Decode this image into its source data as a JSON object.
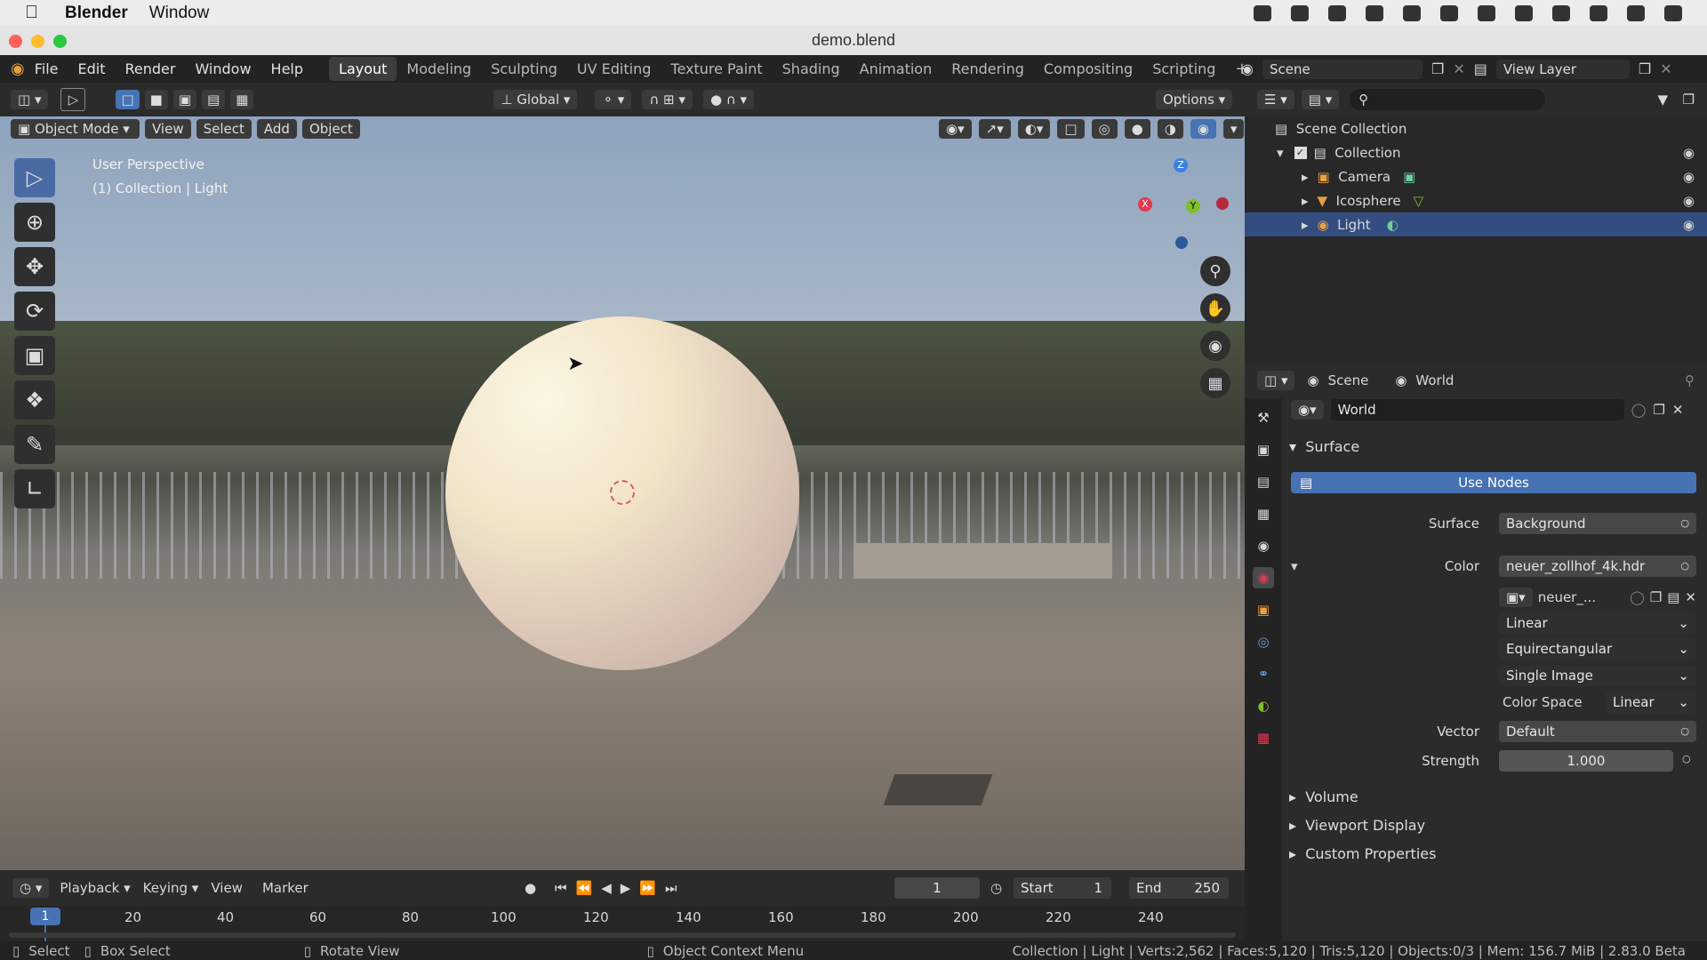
{
  "mac_menubar": {
    "app_name": "Blender",
    "menu_window": "Window"
  },
  "window": {
    "title": "demo.blend"
  },
  "topbar": {
    "menus": [
      "File",
      "Edit",
      "Render",
      "Window",
      "Help"
    ],
    "workspaces": [
      "Layout",
      "Modeling",
      "Sculpting",
      "UV Editing",
      "Texture Paint",
      "Shading",
      "Animation",
      "Rendering",
      "Compositing",
      "Scripting"
    ],
    "active_workspace": "Layout",
    "scene_name": "Scene",
    "view_layer": "View Layer"
  },
  "viewport": {
    "transform_orientation": "Global",
    "options_label": "Options",
    "mode": "Object Mode",
    "header_menus": [
      "View",
      "Select",
      "Add",
      "Object"
    ],
    "overlay_line1": "User Perspective",
    "overlay_line2": "(1) Collection | Light",
    "gizmo_axes": {
      "x": "X",
      "y": "Y",
      "z": "Z"
    }
  },
  "outliner": {
    "root": "Scene Collection",
    "collection": "Collection",
    "items": [
      {
        "label": "Camera",
        "icon": "camera-icon"
      },
      {
        "label": "Icosphere",
        "icon": "mesh-icon"
      },
      {
        "label": "Light",
        "icon": "light-icon",
        "selected": true
      }
    ]
  },
  "properties": {
    "breadcrumb_scene": "Scene",
    "breadcrumb_world": "World",
    "world_name": "World",
    "section_surface": "Surface",
    "use_nodes_label": "Use Nodes",
    "surface_label": "Surface",
    "surface_value": "Background",
    "color_label": "Color",
    "color_value": "neuer_zollhof_4k.hdr",
    "image_short": "neuer_...",
    "interpolation": "Linear",
    "projection": "Equirectangular",
    "source": "Single Image",
    "color_space_label": "Color Space",
    "color_space_value": "Linear",
    "vector_label": "Vector",
    "vector_value": "Default",
    "strength_label": "Strength",
    "strength_value": "1.000",
    "section_volume": "Volume",
    "section_viewport_display": "Viewport Display",
    "section_custom_properties": "Custom Properties"
  },
  "timeline": {
    "playback": "Playback",
    "keying": "Keying",
    "view": "View",
    "marker": "Marker",
    "current_frame": "1",
    "start_label": "Start",
    "start_value": "1",
    "end_label": "End",
    "end_value": "250",
    "ruler_ticks": [
      "1",
      "20",
      "40",
      "60",
      "80",
      "100",
      "120",
      "140",
      "160",
      "180",
      "200",
      "220",
      "240"
    ]
  },
  "statusbar": {
    "select": "Select",
    "box_select": "Box Select",
    "rotate_view": "Rotate View",
    "context_menu": "Object Context Menu",
    "info": "Collection | Light | Verts:2,562 | Faces:5,120 | Tris:5,120 | Objects:0/3 | Mem: 156.7 MiB | 2.83.0 Beta"
  },
  "colors": {
    "accent": "#4772b3",
    "selected_row": "#334d80",
    "x_axis": "#e23a4e",
    "y_axis": "#7fbf2a",
    "z_axis": "#3b7fe0"
  }
}
